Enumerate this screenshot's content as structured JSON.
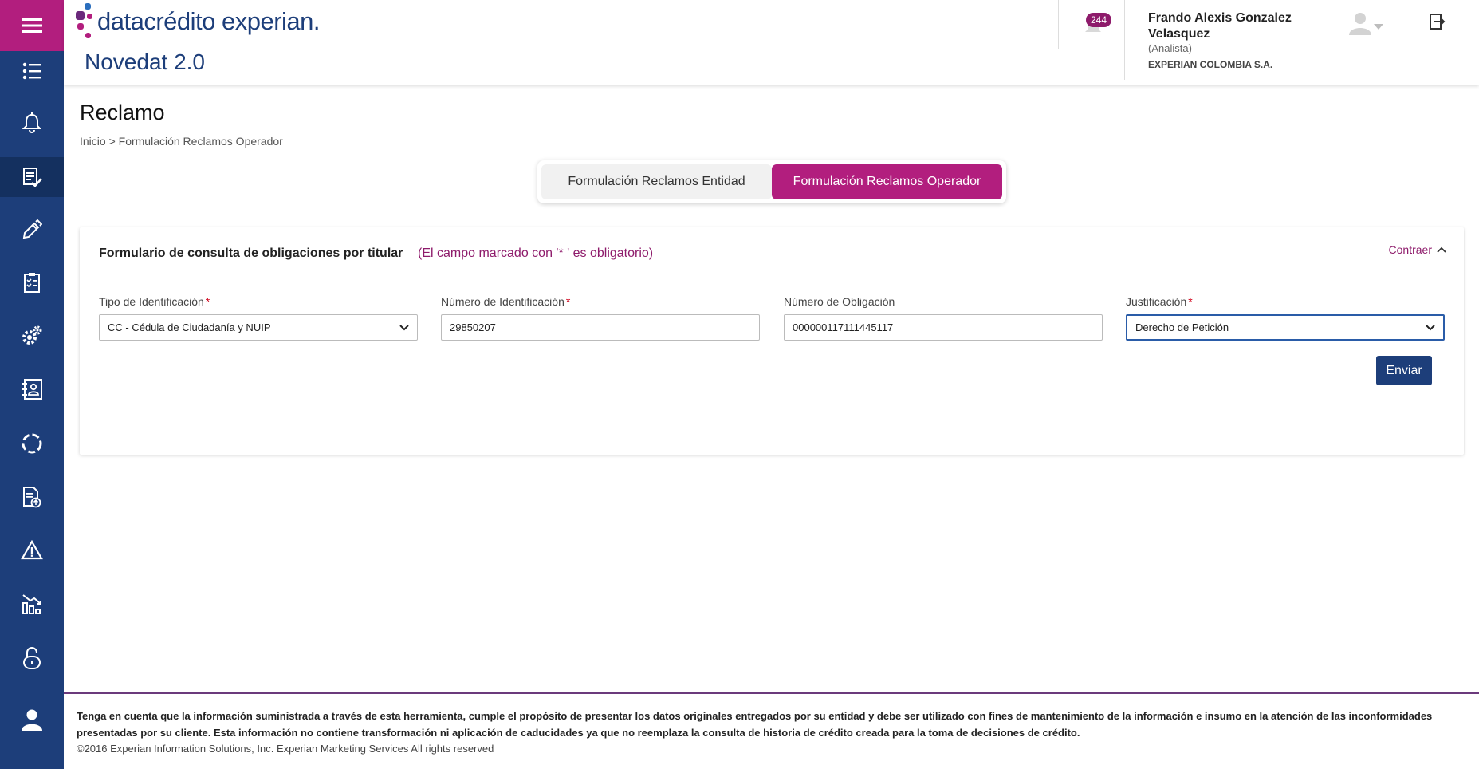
{
  "colors": {
    "sidebar_bg": "#1d3e7a",
    "accent": "#b21e7e",
    "note": "#8e1b6b",
    "primary_button": "#1d3e7a"
  },
  "sidebar": {
    "items": [
      {
        "icon": "list-icon"
      },
      {
        "icon": "bell-icon"
      },
      {
        "icon": "document-check-icon",
        "active": true
      },
      {
        "icon": "pencil-icon"
      },
      {
        "icon": "checklist-icon"
      },
      {
        "icon": "gears-icon"
      },
      {
        "icon": "contact-book-icon"
      },
      {
        "icon": "sync-circle-icon"
      },
      {
        "icon": "document-upload-icon"
      },
      {
        "icon": "warning-icon"
      },
      {
        "icon": "chart-down-icon"
      },
      {
        "icon": "unlock-icon"
      },
      {
        "icon": "user-icon"
      }
    ]
  },
  "header": {
    "logo_text": "datacrédito experian.",
    "app_title": "Novedat 2.0",
    "notification_count": "244",
    "user_name": "Frando Alexis Gonzalez Velasquez",
    "user_role": "(Analista)",
    "user_company": "EXPERIAN COLOMBIA S.A."
  },
  "page": {
    "title": "Reclamo",
    "breadcrumb": "Inicio > Formulación Reclamos Operador"
  },
  "tabs": [
    {
      "label": "Formulación Reclamos Entidad",
      "active": false
    },
    {
      "label": "Formulación Reclamos Operador",
      "active": true
    }
  ],
  "form": {
    "title": "Formulario de consulta de obligaciones por titular",
    "note": "(El campo marcado con '* ' es obligatorio)",
    "collapse_label": "Contraer",
    "fields": {
      "tipo_id": {
        "label": "Tipo de Identificación",
        "value": "CC - Cédula de Ciudadanía y NUIP",
        "required": true
      },
      "numero_id": {
        "label": "Número de Identificación",
        "value": "29850207",
        "required": true
      },
      "numero_obligacion": {
        "label": "Número de Obligación",
        "value": "000000117111445117",
        "required": false
      },
      "justificacion": {
        "label": "Justificación",
        "value": "Derecho de Petición",
        "required": true
      }
    },
    "required_mark": "*",
    "submit_label": "Enviar"
  },
  "footer": {
    "disclaimer": "Tenga en cuenta que la información suministrada a través de esta herramienta, cumple el propósito de presentar los datos originales entregados por su entidad y debe ser utilizado con fines de mantenimiento de la información e insumo en la atención de las inconformidades presentadas por su cliente. Esta información no contiene transformación ni aplicación de caducidades ya que no reemplaza la consulta de historia de crédito creada para la toma de decisiones de crédito.",
    "copyright": "©2016 Experian Information Solutions, Inc. Experian Marketing Services All rights reserved"
  }
}
